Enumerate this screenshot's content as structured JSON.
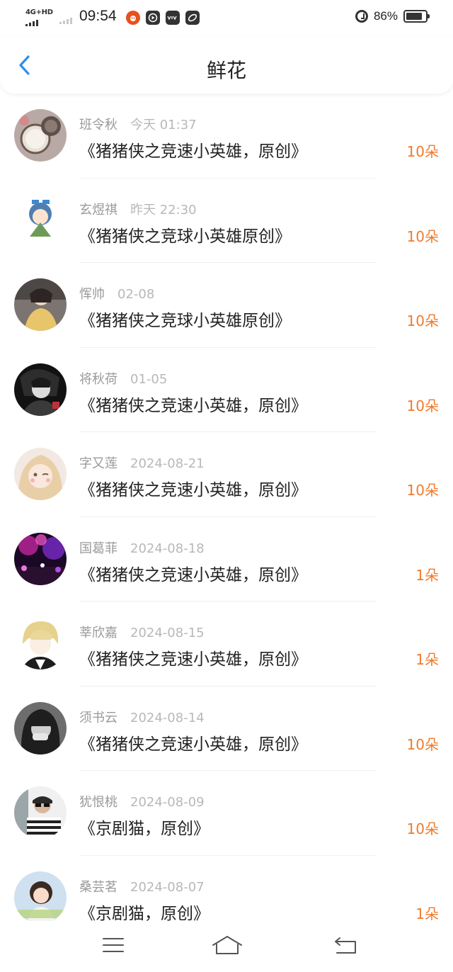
{
  "status_bar": {
    "network": "4G+HD",
    "time": "09:54",
    "battery_percent": "86%",
    "battery_level": 0.86,
    "apps": [
      "taobao-icon",
      "video-icon",
      "vivo-icon",
      "link-icon"
    ]
  },
  "header": {
    "title": "鲜花",
    "back_icon": "chevron-left-icon",
    "accent": "#2f8fe8"
  },
  "colors": {
    "count": "#f07a2b",
    "name": "#9a9a9a",
    "date": "#b8b8b8"
  },
  "items": [
    {
      "name": "班令秋",
      "date": "今天 01:37",
      "title": "《猪猪侠之竞速小英雄，原创》",
      "count": "10朵",
      "avatar": "pocket-watch"
    },
    {
      "name": "玄煜祺",
      "date": "昨天 22:30",
      "title": "《猪猪侠之竞球小英雄原创》",
      "count": "10朵",
      "avatar": "anime-girl"
    },
    {
      "name": "恽帅",
      "date": "02-08",
      "title": "《猪猪侠之竞球小英雄原创》",
      "count": "10朵",
      "avatar": "girl-yellow-sweater"
    },
    {
      "name": "将秋荷",
      "date": "01-05",
      "title": "《猪猪侠之竞速小英雄，原创》",
      "count": "10朵",
      "avatar": "dark-anime-boy"
    },
    {
      "name": "字又莲",
      "date": "2024-08-21",
      "title": "《猪猪侠之竞速小英雄，原创》",
      "count": "10朵",
      "avatar": "anime-girl-wink"
    },
    {
      "name": "国葛菲",
      "date": "2024-08-18",
      "title": "《猪猪侠之竞速小英雄，原创》",
      "count": "1朵",
      "avatar": "concert-lights"
    },
    {
      "name": "莘欣嘉",
      "date": "2024-08-15",
      "title": "《猪猪侠之竞速小英雄，原创》",
      "count": "1朵",
      "avatar": "anime-blond-boy"
    },
    {
      "name": "须书云",
      "date": "2024-08-14",
      "title": "《猪猪侠之竞速小英雄，原创》",
      "count": "10朵",
      "avatar": "girl-bw"
    },
    {
      "name": "犹恨桃",
      "date": "2024-08-09",
      "title": "《京剧猫，原创》",
      "count": "10朵",
      "avatar": "boy-sunglasses"
    },
    {
      "name": "桑芸茗",
      "date": "2024-08-07",
      "title": "《京剧猫，原创》",
      "count": "1朵",
      "avatar": "girl-short-hair"
    }
  ],
  "bottom_nav": {
    "icons": [
      "menu-icon",
      "home-icon",
      "back-icon"
    ]
  }
}
